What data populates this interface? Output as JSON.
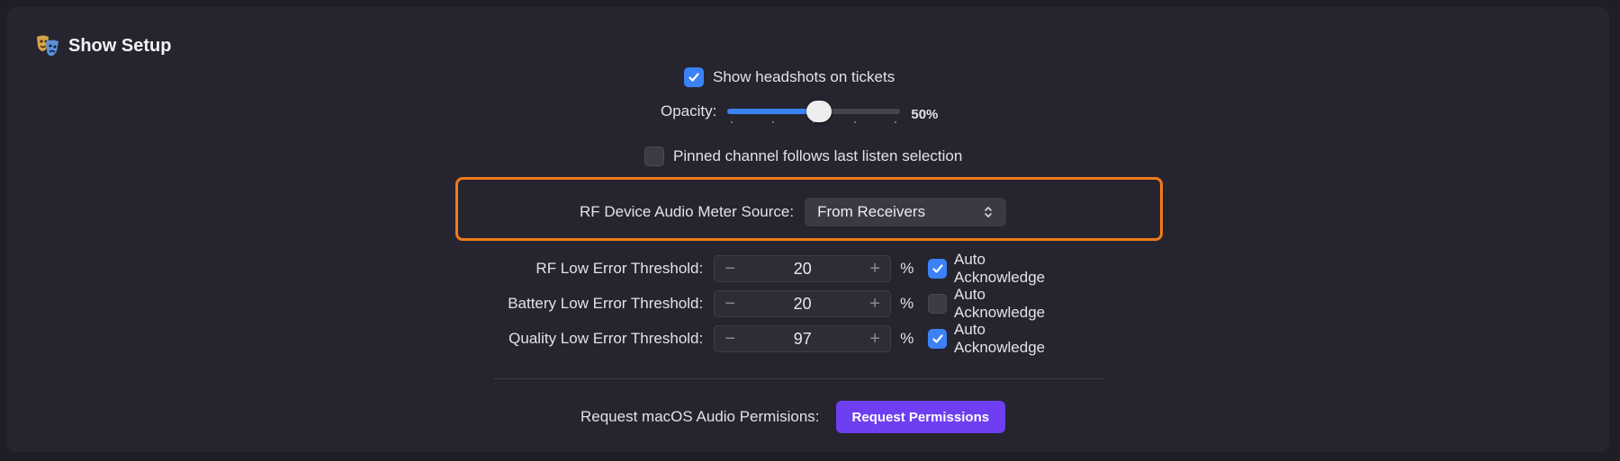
{
  "header": {
    "title": "Show Setup",
    "icon": "theater-masks-icon"
  },
  "headshots": {
    "label": "Show headshots on tickets",
    "checked": true
  },
  "opacity": {
    "label": "Opacity:",
    "value_text": "50%",
    "value": 0.5
  },
  "pinned": {
    "label": "Pinned channel follows last listen selection",
    "checked": false
  },
  "meter_source": {
    "label": "RF Device Audio Meter Source:",
    "selected": "From Receivers"
  },
  "thresholds": [
    {
      "label": "RF Low Error Threshold:",
      "value": "20",
      "unit": "%",
      "ack_label": "Auto Acknowledge",
      "ack_checked": true
    },
    {
      "label": "Battery Low Error Threshold:",
      "value": "20",
      "unit": "%",
      "ack_label": "Auto Acknowledge",
      "ack_checked": false
    },
    {
      "label": "Quality Low Error Threshold:",
      "value": "97",
      "unit": "%",
      "ack_label": "Auto Acknowledge",
      "ack_checked": true
    }
  ],
  "permissions": {
    "label": "Request macOS Audio Permisions:",
    "button_label": "Request Permissions"
  },
  "colors": {
    "accent": "#3b82f6",
    "highlight": "#f07a1a",
    "primary_button": "#6d3ff0"
  }
}
